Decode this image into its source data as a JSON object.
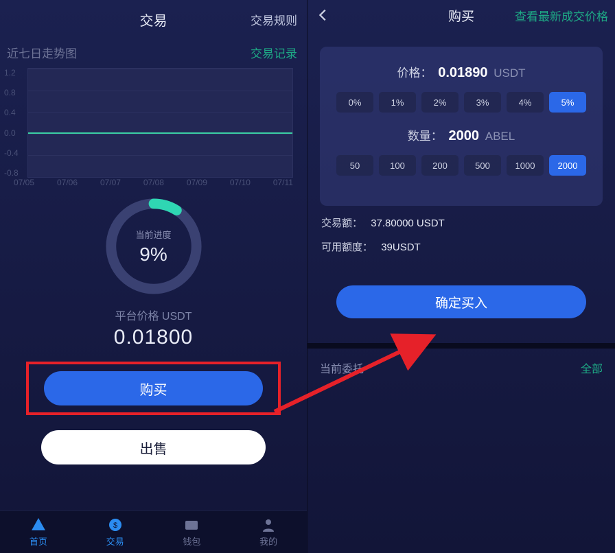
{
  "left": {
    "title": "交易",
    "rules_link": "交易规则",
    "trend_label": "近七日走势图",
    "records_link": "交易记录",
    "progress": {
      "label": "当前进度",
      "value": "9%",
      "fraction": 0.09
    },
    "price_label": "平台价格 USDT",
    "price_value": "0.01800",
    "buy_label": "购买",
    "sell_label": "出售",
    "nav": {
      "home": "首页",
      "trade": "交易",
      "wallet": "钱包",
      "mine": "我的"
    }
  },
  "right": {
    "title": "购买",
    "latest_link": "查看最新成交价格",
    "price_label": "价格：",
    "price_value": "0.01890",
    "price_unit": "USDT",
    "pct_options": [
      "0%",
      "1%",
      "2%",
      "3%",
      "4%",
      "5%"
    ],
    "pct_selected": "5%",
    "qty_label": "数量：",
    "qty_value": "2000",
    "qty_unit": "ABEL",
    "qty_options": [
      "50",
      "100",
      "200",
      "500",
      "1000",
      "2000"
    ],
    "qty_selected": "2000",
    "amount_label": "交易额：",
    "amount_value": "37.80000 USDT",
    "avail_label": "可用额度：",
    "avail_value": "39USDT",
    "confirm_label": "确定买入",
    "orders_label": "当前委托",
    "all_label": "全部"
  },
  "chart_data": {
    "type": "line",
    "title": "近七日走势图",
    "xlabel": "",
    "ylabel": "",
    "ylim": [
      -0.8,
      1.2
    ],
    "y_ticks": [
      1.2,
      0.8,
      0.4,
      0.0,
      -0.4,
      -0.8
    ],
    "categories": [
      "07/05",
      "07/06",
      "07/07",
      "07/08",
      "07/09",
      "07/10",
      "07/11"
    ],
    "series": [
      {
        "name": "price",
        "values": [
          0.018,
          0.018,
          0.018,
          0.018,
          0.018,
          0.018,
          0.018
        ]
      }
    ]
  }
}
